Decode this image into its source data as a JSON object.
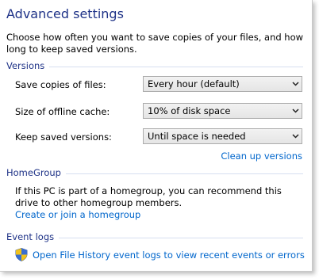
{
  "title": "Advanced settings",
  "intro": "Choose how often you want to save copies of your files, and how long to keep saved versions.",
  "versions": {
    "heading": "Versions",
    "rows": [
      {
        "label": "Save copies of files:",
        "value": "Every hour (default)"
      },
      {
        "label": "Size of offline cache:",
        "value": "10% of disk space"
      },
      {
        "label": "Keep saved versions:",
        "value": "Until space is needed"
      }
    ],
    "cleanup_link": "Clean up versions"
  },
  "homegroup": {
    "heading": "HomeGroup",
    "text": "If this PC is part of a homegroup, you can recommend this drive to other homegroup members.",
    "link": "Create or join a homegroup"
  },
  "event_logs": {
    "heading": "Event logs",
    "link": "Open File History event logs to view recent events or errors",
    "icon": "uac-shield-icon"
  },
  "colors": {
    "heading_blue": "#1e3287",
    "link_blue": "#0066cc",
    "separator": "#d6dff0"
  }
}
